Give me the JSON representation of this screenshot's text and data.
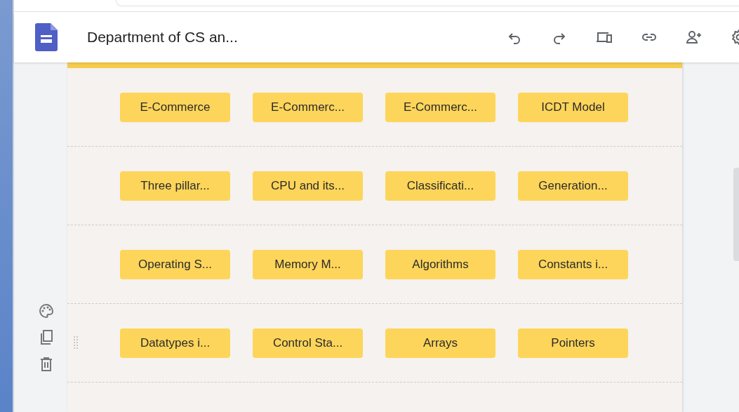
{
  "header": {
    "title": "Department of CS an..."
  },
  "rows": [
    {
      "hovered": false,
      "buttons": [
        "E-Commerce",
        "E-Commerc...",
        "E-Commerc...",
        "ICDT Model"
      ]
    },
    {
      "hovered": false,
      "buttons": [
        "Three pillar...",
        "CPU and its...",
        "Classificati...",
        "Generation..."
      ]
    },
    {
      "hovered": false,
      "buttons": [
        "Operating S...",
        "Memory M...",
        "Algorithms",
        "Constants i..."
      ]
    },
    {
      "hovered": true,
      "buttons": [
        "Datatypes i...",
        "Control Sta...",
        "Arrays",
        "Pointers"
      ]
    }
  ]
}
